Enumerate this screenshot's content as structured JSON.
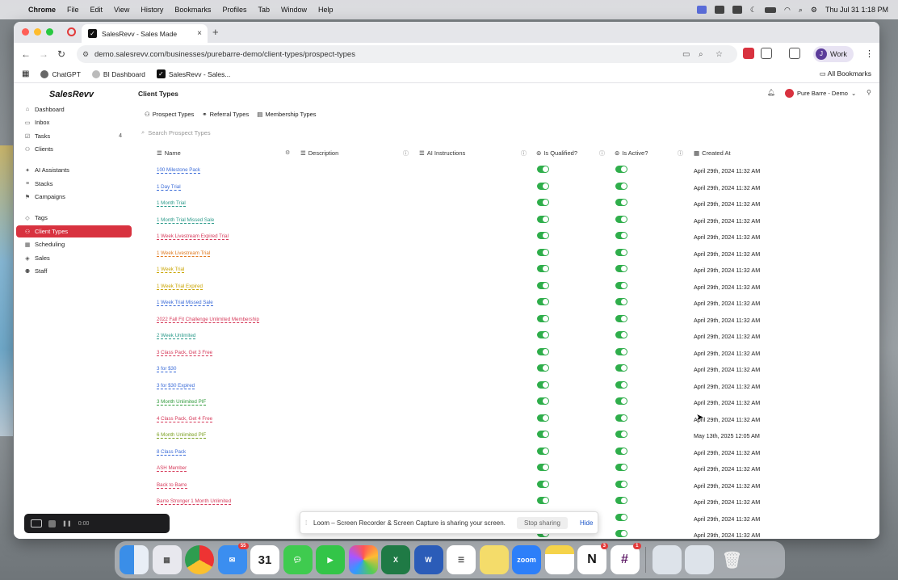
{
  "menubar": {
    "app": "Chrome",
    "items": [
      "File",
      "Edit",
      "View",
      "History",
      "Bookmarks",
      "Profiles",
      "Tab",
      "Window",
      "Help"
    ],
    "clock": "Thu Jul 31  1:18 PM"
  },
  "browser": {
    "tab_title": "SalesRevv - Sales Made",
    "url": "demo.salesrevv.com/businesses/purebarre-demo/client-types/prospect-types",
    "profile": "Work",
    "profile_initial": "J",
    "bookmarks": [
      "ChatGPT",
      "BI Dashboard",
      "SalesRevv - Sales..."
    ],
    "all_bookmarks": "All Bookmarks"
  },
  "sidebar": {
    "logo": "SalesRevv",
    "items": [
      {
        "label": "Dashboard",
        "icon": "home-icon"
      },
      {
        "label": "Inbox",
        "icon": "inbox-icon"
      },
      {
        "label": "Tasks",
        "icon": "tasks-icon",
        "badge": "4"
      },
      {
        "label": "Clients",
        "icon": "clients-icon"
      },
      {
        "label": "AI Assistants",
        "icon": "ai-icon"
      },
      {
        "label": "Stacks",
        "icon": "stacks-icon"
      },
      {
        "label": "Campaigns",
        "icon": "campaign-icon"
      },
      {
        "label": "Tags",
        "icon": "tag-icon"
      },
      {
        "label": "Client Types",
        "icon": "client-types-icon",
        "active": true
      },
      {
        "label": "Scheduling",
        "icon": "calendar-icon"
      },
      {
        "label": "Sales",
        "icon": "sales-icon"
      },
      {
        "label": "Staff",
        "icon": "staff-icon"
      }
    ]
  },
  "main": {
    "title": "Client Types",
    "org": "Pure Barre - Demo",
    "subtabs": [
      "Prospect Types",
      "Referral Types",
      "Membership Types"
    ],
    "search_placeholder": "Search Prospect Types",
    "columns": [
      "Name",
      "Description",
      "AI Instructions",
      "Is Qualified?",
      "Is Active?",
      "Created At"
    ],
    "rows": [
      {
        "name": "100 Milestone Pack",
        "color": "#3a6bd8",
        "date": "April 29th, 2024 11:32 AM"
      },
      {
        "name": "1 Day Trial",
        "color": "#3a6bd8",
        "date": "April 29th, 2024 11:32 AM"
      },
      {
        "name": "1 Month Trial",
        "color": "#2a9a8a",
        "date": "April 29th, 2024 11:32 AM"
      },
      {
        "name": "1 Month Trial Missed Sale",
        "color": "#2a9a8a",
        "date": "April 29th, 2024 11:32 AM"
      },
      {
        "name": "1 Week Livestream Expired Trial",
        "color": "#d63a5a",
        "date": "April 29th, 2024 11:32 AM"
      },
      {
        "name": "1 Week Livestream Trial",
        "color": "#e07a20",
        "date": "April 29th, 2024 11:32 AM"
      },
      {
        "name": "1 Week Trial",
        "color": "#c9a400",
        "date": "April 29th, 2024 11:32 AM"
      },
      {
        "name": "1 Week Trial Expired",
        "color": "#c9a400",
        "date": "April 29th, 2024 11:32 AM"
      },
      {
        "name": "1 Week Trial Missed Sale",
        "color": "#3a6bd8",
        "date": "April 29th, 2024 11:32 AM"
      },
      {
        "name": "2022 Fall Fit Challenge Unlimited Membership",
        "color": "#d63a5a",
        "date": "April 29th, 2024 11:32 AM"
      },
      {
        "name": "2 Week Unlimited",
        "color": "#2a9a8a",
        "date": "April 29th, 2024 11:32 AM"
      },
      {
        "name": "3 Class Pack, Get 3 Free",
        "color": "#d63a5a",
        "date": "April 29th, 2024 11:32 AM"
      },
      {
        "name": "3 for $30",
        "color": "#3a6bd8",
        "date": "April 29th, 2024 11:32 AM"
      },
      {
        "name": "3 for $30 Expired",
        "color": "#3a6bd8",
        "date": "April 29th, 2024 11:32 AM"
      },
      {
        "name": "3 Month Unlimited PIF",
        "color": "#2f9a3a",
        "date": "April 29th, 2024 11:32 AM"
      },
      {
        "name": "4 Class Pack, Get 4 Free",
        "color": "#d63a5a",
        "date": "April 29th, 2024 11:32 AM"
      },
      {
        "name": "6 Month Unlimited PIF",
        "color": "#7aa020",
        "date": "May 13th, 2025 12:05 AM"
      },
      {
        "name": "8 Class Pack",
        "color": "#3a6bd8",
        "date": "April 29th, 2024 11:32 AM"
      },
      {
        "name": "ASH Member",
        "color": "#d63a5a",
        "date": "April 29th, 2024 11:32 AM"
      },
      {
        "name": "Back to Barre",
        "color": "#d63a5a",
        "date": "April 29th, 2024 11:32 AM"
      },
      {
        "name": "Barre Stronger 1 Month Unlimited",
        "color": "#d63a5a",
        "date": "April 29th, 2024 11:32 AM"
      },
      {
        "name": "",
        "color": "#2a9a8a",
        "date": "April 29th, 2024 11:32 AM"
      },
      {
        "name": "",
        "color": "#d63a5a",
        "date": "April 29th, 2024 11:32 AM"
      }
    ]
  },
  "loom": {
    "message": "Loom – Screen Recorder & Screen Capture is sharing your screen.",
    "stop_label": "Stop sharing",
    "hide_label": "Hide"
  },
  "recorder": {
    "time": "0:00"
  },
  "dock": {
    "calendar_day": "31",
    "mail_badge": "55",
    "notion_badge": "3",
    "slack_badge": "1",
    "zoom_label": "zoom"
  },
  "colors": {
    "accent": "#d8323f",
    "toggle_on": "#2fae4b",
    "link": "#1a55c8"
  }
}
